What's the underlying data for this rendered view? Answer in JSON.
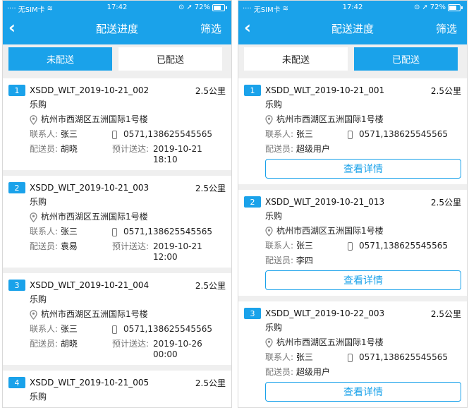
{
  "status": {
    "carrier": "无SIM卡",
    "time": "17:42",
    "battery": "72%"
  },
  "nav": {
    "back_icon": "chevron-left-icon",
    "title": "配送进度",
    "filter": "筛选"
  },
  "tabs": {
    "undelivered": "未配送",
    "delivered": "已配送"
  },
  "colors": {
    "accent": "#1aa2ea",
    "background": "#efefef"
  },
  "labels": {
    "contact": "联系人:",
    "courier": "配送员:",
    "eta": "预计送达:",
    "detail_button": "查看详情"
  },
  "left_screen": {
    "active_tab": "undelivered",
    "orders": [
      {
        "num": "1",
        "order_no": "XSDD_WLT_2019-10-21_002",
        "distance": "2.5公里",
        "shop": "乐购",
        "address": "杭州市西湖区五洲国际1号楼",
        "contact": "张三",
        "phone": "0571,138625545565",
        "courier": "胡晓",
        "eta_date": "2019-10-21",
        "eta_time": "18:10"
      },
      {
        "num": "2",
        "order_no": "XSDD_WLT_2019-10-21_003",
        "distance": "2.5公里",
        "shop": "乐购",
        "address": "杭州市西湖区五洲国际1号楼",
        "contact": "张三",
        "phone": "0571,138625545565",
        "courier": "袁易",
        "eta_date": "2019-10-21",
        "eta_time": "12:00"
      },
      {
        "num": "3",
        "order_no": "XSDD_WLT_2019-10-21_004",
        "distance": "2.5公里",
        "shop": "乐购",
        "address": "杭州市西湖区五洲国际1号楼",
        "contact": "张三",
        "phone": "0571,138625545565",
        "courier": "胡晓",
        "eta_date": "2019-10-26",
        "eta_time": "00:00"
      },
      {
        "num": "4",
        "order_no": "XSDD_WLT_2019-10-21_005",
        "distance": "2.5公里",
        "shop": "乐购"
      }
    ]
  },
  "right_screen": {
    "active_tab": "delivered",
    "orders": [
      {
        "num": "1",
        "order_no": "XSDD_WLT_2019-10-21_001",
        "distance": "2.5公里",
        "shop": "乐购",
        "address": "杭州市西湖区五洲国际1号楼",
        "contact": "张三",
        "phone": "0571,138625545565",
        "courier": "超级用户"
      },
      {
        "num": "2",
        "order_no": "XSDD_WLT_2019-10-21_013",
        "distance": "2.5公里",
        "shop": "乐购",
        "address": "杭州市西湖区五洲国际1号楼",
        "contact": "张三",
        "phone": "0571,138625545565",
        "courier": "李四"
      },
      {
        "num": "3",
        "order_no": "XSDD_WLT_2019-10-22_003",
        "distance": "2.5公里",
        "shop": "乐购",
        "address": "杭州市西湖区五洲国际1号楼",
        "contact": "张三",
        "phone": "0571,138625545565",
        "courier": "超级用户"
      }
    ]
  }
}
